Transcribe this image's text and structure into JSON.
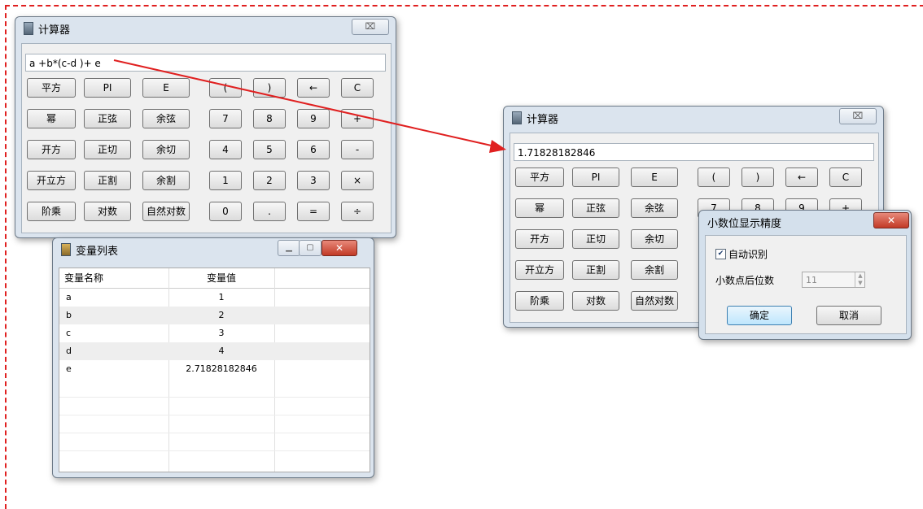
{
  "calc1": {
    "title": "计算器",
    "close": "⌧",
    "expression": "a +b*(c-d )+ e",
    "buttons": [
      "平方",
      "PI",
      "E",
      "(",
      ")",
      "←",
      "C",
      "幂",
      "正弦",
      "余弦",
      "7",
      "8",
      "9",
      "+",
      "开方",
      "正切",
      "余切",
      "4",
      "5",
      "6",
      "-",
      "开立方",
      "正割",
      "余割",
      "1",
      "2",
      "3",
      "×",
      "阶乘",
      "对数",
      "自然对数",
      "0",
      ".",
      "=",
      "÷"
    ]
  },
  "varlist": {
    "title": "变量列表",
    "col_name": "变量名称",
    "col_value": "变量值",
    "rows": [
      {
        "name": "a",
        "value": "1"
      },
      {
        "name": "b",
        "value": "2"
      },
      {
        "name": "c",
        "value": "3"
      },
      {
        "name": "d",
        "value": "4"
      },
      {
        "name": "e",
        "value": "2.71828182846"
      }
    ]
  },
  "calc2": {
    "title": "计算器",
    "close": "⌧",
    "result": "1.71828182846",
    "buttons": [
      "平方",
      "PI",
      "E",
      "(",
      ")",
      "←",
      "C",
      "幂",
      "正弦",
      "余弦",
      "7",
      "8",
      "9",
      "+",
      "开方",
      "正切",
      "余切",
      "开立方",
      "正割",
      "余割",
      "阶乘",
      "对数",
      "自然对数"
    ]
  },
  "precision_dialog": {
    "title": "小数位显示精度",
    "close": "✕",
    "auto_detect_label": "自动识别",
    "auto_detect_checked": true,
    "decimal_places_label": "小数点后位数",
    "decimal_places_value": "11",
    "ok": "确定",
    "cancel": "取消"
  },
  "colors": {
    "annotation_red": "#e02020",
    "window_frame": "#dbe4ee",
    "close_red": "#c23a26"
  }
}
